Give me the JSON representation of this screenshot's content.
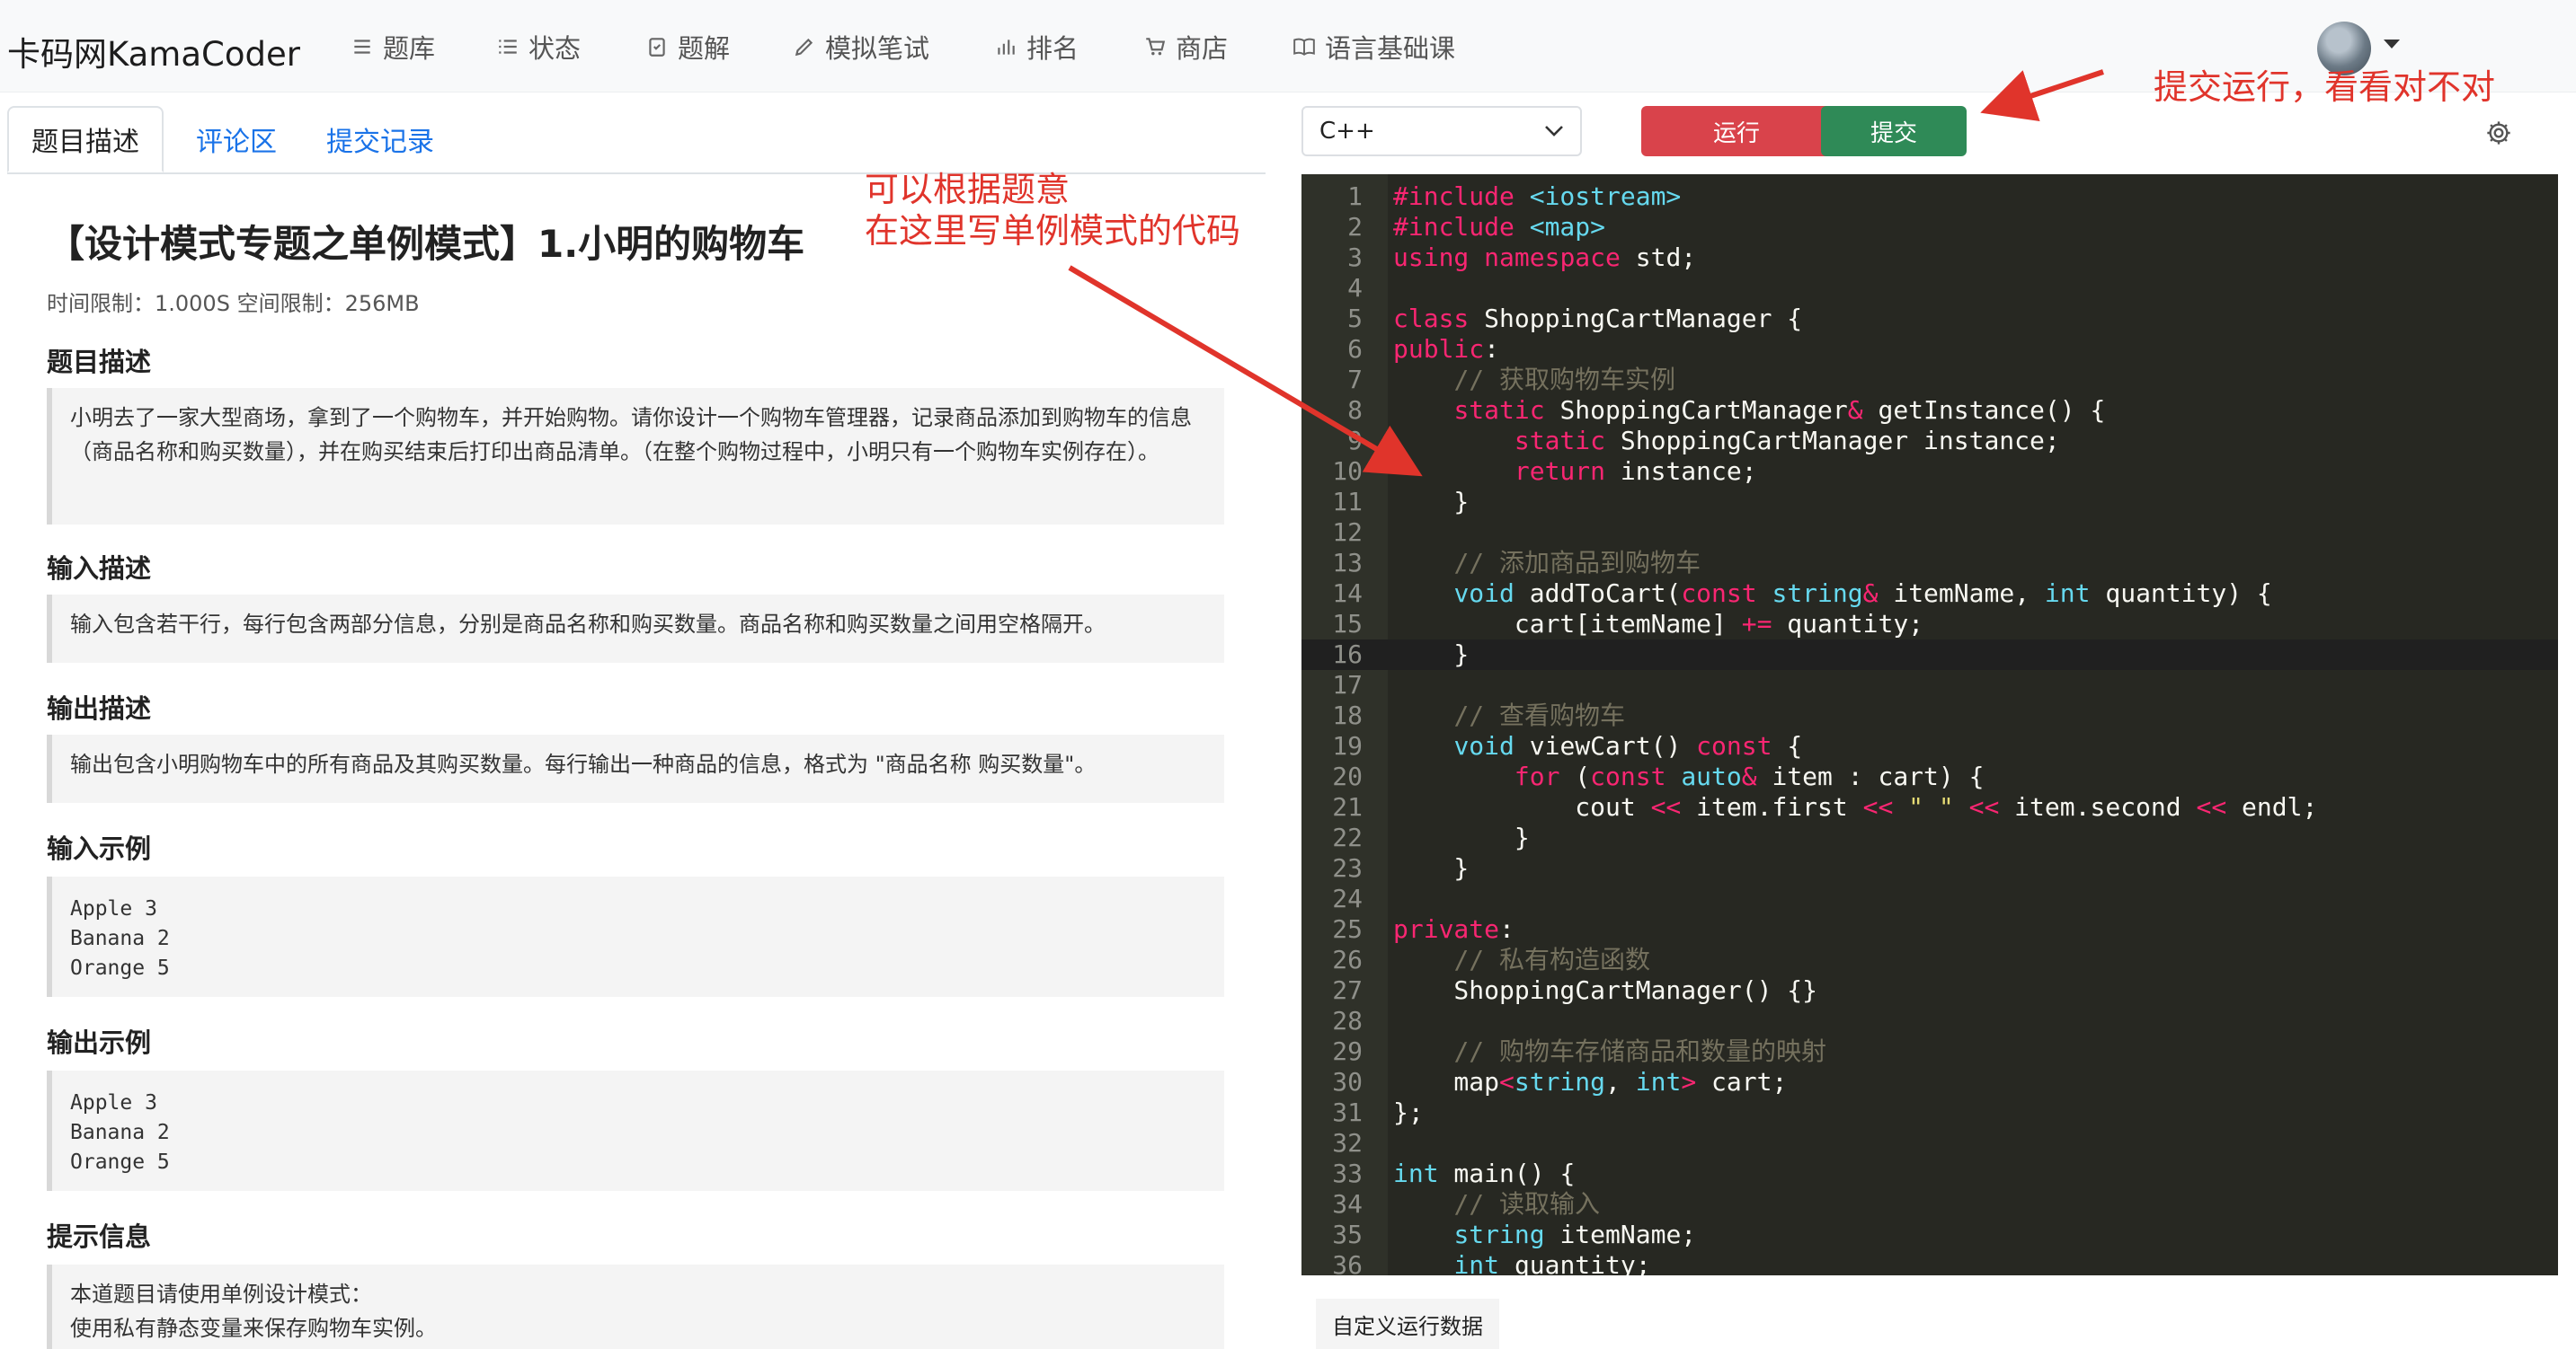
{
  "nav": {
    "brand": "卡码网KamaCoder",
    "items": [
      {
        "label": "题库",
        "icon": "list-icon"
      },
      {
        "label": "状态",
        "icon": "status-list-icon"
      },
      {
        "label": "题解",
        "icon": "clipboard-check-icon"
      },
      {
        "label": "模拟笔试",
        "icon": "pencil-icon"
      },
      {
        "label": "排名",
        "icon": "bar-chart-icon"
      },
      {
        "label": "商店",
        "icon": "cart-icon"
      },
      {
        "label": "语言基础课",
        "icon": "book-icon"
      }
    ]
  },
  "tabs": [
    "题目描述",
    "评论区",
    "提交记录"
  ],
  "problem": {
    "title": "【设计模式专题之单例模式】1.小明的购物车",
    "limits": "时间限制：1.000S  空间限制：256MB",
    "sections": {
      "desc_head": "题目描述",
      "desc_body": "小明去了一家大型商场，拿到了一个购物车，并开始购物。请你设计一个购物车管理器，记录商品添加到购物车的信息（商品名称和购买数量），并在购买结束后打印出商品清单。（在整个购物过程中，小明只有一个购物车实例存在）。",
      "input_head": "输入描述",
      "input_body": "输入包含若干行，每行包含两部分信息，分别是商品名称和购买数量。商品名称和购买数量之间用空格隔开。",
      "output_head": "输出描述",
      "output_body": "输出包含小明购物车中的所有商品及其购买数量。每行输出一种商品的信息，格式为 \"商品名称 购买数量\"。",
      "input_example_head": "输入示例",
      "input_example": "Apple 3\nBanana 2\nOrange 5",
      "output_example_head": "输出示例",
      "output_example": "Apple 3\nBanana 2\nOrange 5",
      "hint_head": "提示信息",
      "hint_body_1": "本道题目请使用单例设计模式：",
      "hint_body_2": "使用私有静态变量来保存购物车实例。"
    }
  },
  "toolbar": {
    "language": "C++",
    "run_label": "运行",
    "submit_label": "提交",
    "colors": {
      "run": "#d9434b",
      "submit": "#2f8a57"
    }
  },
  "editor": {
    "active_line": 16,
    "lines": [
      "#include <iostream>",
      "#include <map>",
      "using namespace std;",
      "",
      "class ShoppingCartManager {",
      "public:",
      "    // 获取购物车实例",
      "    static ShoppingCartManager& getInstance() {",
      "        static ShoppingCartManager instance;",
      "        return instance;",
      "    }",
      "",
      "    // 添加商品到购物车",
      "    void addToCart(const string& itemName, int quantity) {",
      "        cart[itemName] += quantity;",
      "    }",
      "",
      "    // 查看购物车",
      "    void viewCart() const {",
      "        for (const auto& item : cart) {",
      "            cout << item.first << \" \" << item.second << endl;",
      "        }",
      "    }",
      "",
      "private:",
      "    // 私有构造函数",
      "    ShoppingCartManager() {}",
      "",
      "    // 购物车存储商品和数量的映射",
      "    map<string, int> cart;",
      "};",
      "",
      "int main() {",
      "    // 读取输入",
      "    string itemName;",
      "    int quantity;"
    ]
  },
  "custom_run_label": "自定义运行数据",
  "annotations": {
    "note_editor_line1": "可以根据题意",
    "note_editor_line2": "在这里写单例模式的代码",
    "note_submit": "提交运行，看看对不对",
    "color": "#e0342b"
  }
}
